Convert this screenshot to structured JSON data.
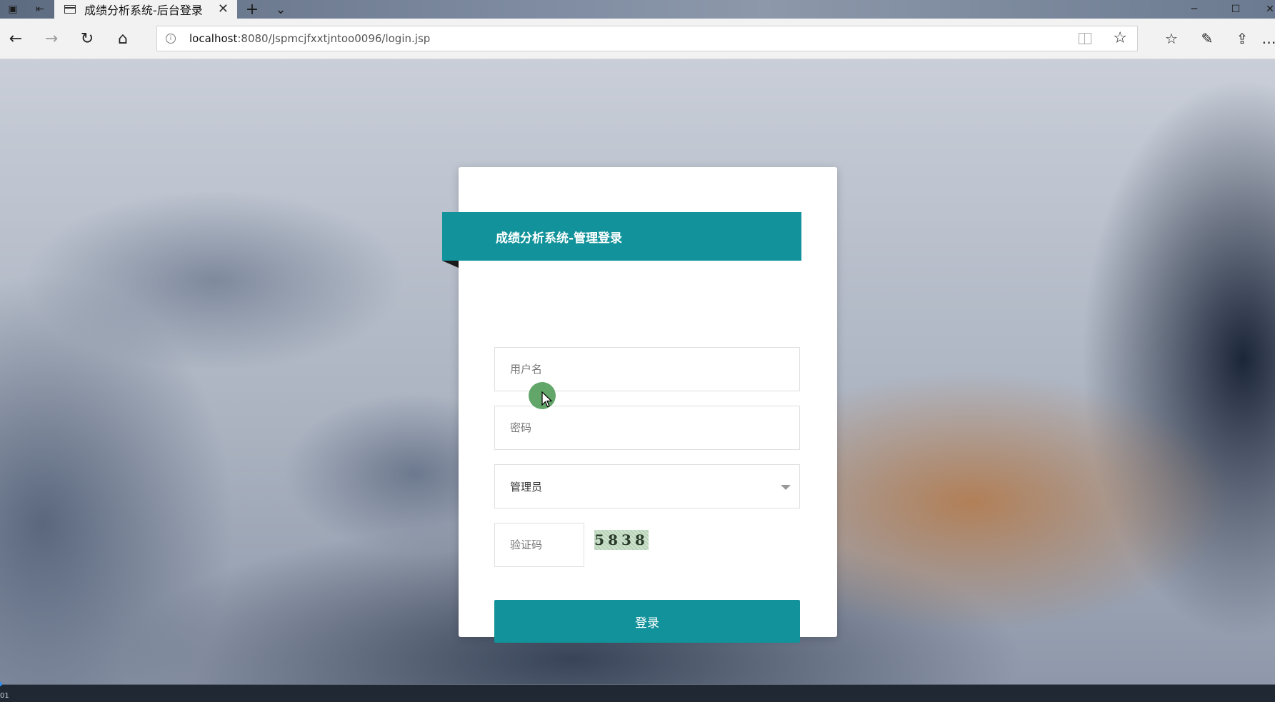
{
  "browser": {
    "tab_title": "成绩分析系统-后台登录",
    "url_host": "localhost",
    "url_path": ":8080/Jspmcjfxxtjntoo0096/login.jsp",
    "new_tab_symbol": "+",
    "tab_list_symbol": "⌄"
  },
  "login": {
    "header_title": "成绩分析系统-管理登录",
    "username_placeholder": "用户名",
    "password_placeholder": "密码",
    "role_selected": "管理员",
    "captcha_placeholder": "验证码",
    "captcha_code": "5838",
    "submit_label": "登录"
  },
  "timeline": {
    "time": "01"
  },
  "colors": {
    "accent": "#12929a",
    "header_fold": "#1a1a1a"
  }
}
